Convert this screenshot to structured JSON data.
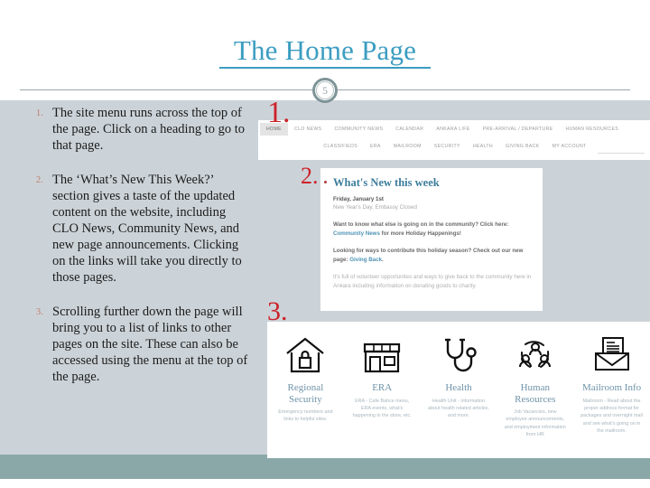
{
  "slide": {
    "title": "The Home Page",
    "page_number": "5",
    "title_color": "#3c9dc1",
    "callout_color": "#cc2229",
    "footer_color": "#8aa8a8",
    "background_color": "#ccd3d8"
  },
  "instructions": [
    {
      "number": "1.",
      "text": "The site menu runs across the top of the page. Click on a heading to go to that page."
    },
    {
      "number": "2.",
      "text": "The ‘What’s New This Week?’ section gives a taste of the updated content on the website, including CLO News, Community News, and new page announcements. Clicking on the links will take you directly to those pages."
    },
    {
      "number": "3.",
      "text": "Scrolling further down the page will bring you to a list of links to other pages on the site. These can also be accessed using the menu at the top of the page."
    }
  ],
  "callouts": {
    "one": "1.",
    "two": "2.",
    "three": "3."
  },
  "site_menu": {
    "row1": [
      "HOME",
      "CLO NEWS",
      "COMMUNITY NEWS",
      "CALENDAR",
      "ANKARA LIFE",
      "PRE-ARRIVAL / DEPARTURE",
      "HUMAN RESOURCES"
    ],
    "row2": [
      "CLASSIFIEDS",
      "ERA",
      "MAILROOM",
      "SECURITY",
      "HEALTH",
      "GIVING BACK",
      "MY ACCOUNT"
    ],
    "active": "HOME"
  },
  "whats_new": {
    "heading": "What's New this week",
    "date": "Friday, January 1st",
    "subtitle": "New Year's Day. Embassy Closed",
    "para1_before": "Want to know what else is going on in the community? Click here: ",
    "para1_link": "Community News",
    "para1_after": " for more Holiday Happenings!",
    "para2_before": "Looking for ways to contribute this holiday season? Check out our new page: ",
    "para2_link": "Giving Back",
    "para2_after": ".",
    "para3": "It's full of volunteer opportunites and ways to give back to the community here in Ankara including information on donating goods to charity."
  },
  "tiles": [
    {
      "icon": "house-lock-icon",
      "title": "Regional Security",
      "desc": "Emergency numbers and links to helpful sites."
    },
    {
      "icon": "storefront-icon",
      "title": "ERA",
      "desc": "ERA - Cafe Bahce menu, ERA events, what's happening in the store, etc."
    },
    {
      "icon": "stethoscope-icon",
      "title": "Health",
      "desc": "Health Unit - information about health related articles, and more."
    },
    {
      "icon": "people-circle-icon",
      "title": "Human Resources",
      "desc": "Job Vacancies, new employee announcements, and employment information from HR"
    },
    {
      "icon": "envelope-letter-icon",
      "title": "Mailroom Info",
      "desc": "Mailroom - Read about the proper address format for packages and overnight mail and see what's going on in the mailroom."
    }
  ]
}
